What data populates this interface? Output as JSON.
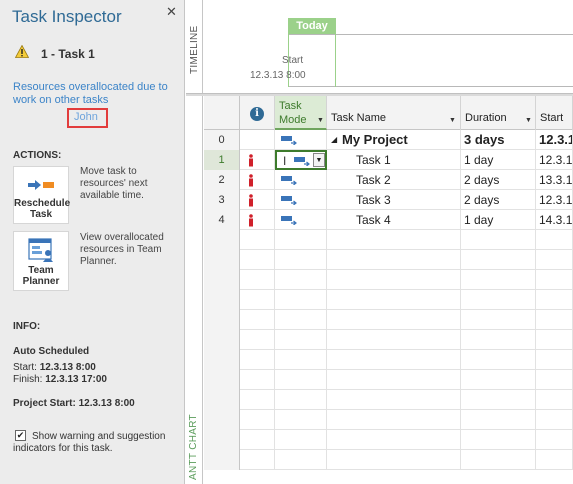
{
  "inspector": {
    "title": "Task Inspector",
    "close_glyph": "✕",
    "task_heading": "1 - Task 1",
    "message": "Resources overallocated due to work on other tasks",
    "resource_link": "John",
    "actions_label": "ACTIONS:",
    "actions": [
      {
        "label_line1": "Reschedule",
        "label_line2": "Task",
        "description": "Move task to resources' next available time.",
        "icon": "reschedule-icon"
      },
      {
        "label_line1": "Team",
        "label_line2": "Planner",
        "description": "View overallocated resources in Team Planner.",
        "icon": "team-planner-icon"
      }
    ],
    "info_label": "INFO:",
    "auto_scheduled": "Auto Scheduled",
    "start_label": "Start:",
    "start_value": "12.3.13 8:00",
    "finish_label": "Finish:",
    "finish_value": "12.3.13 17:00",
    "project_start_label": "Project Start:",
    "project_start_value": "12.3.13 8:00",
    "checkbox_checked": true,
    "checkbox_label": "Show warning and suggestion indicators for this task."
  },
  "timeline": {
    "side_label": "TIMELINE",
    "today_label": "Today",
    "start_label": "Start",
    "start_date": "12.3.13 8:00"
  },
  "gantt": {
    "side_label": "ANTT CHART",
    "columns": {
      "info_glyph": "i",
      "task_mode_line1": "Task",
      "task_mode_line2": "Mode",
      "task_name": "Task Name",
      "duration": "Duration",
      "start": "Start"
    },
    "rows": [
      {
        "id": "0",
        "name": "My Project",
        "duration": "3 days",
        "start": "12.3.1",
        "summary": true,
        "warning": false
      },
      {
        "id": "1",
        "name": "Task 1",
        "duration": "1 day",
        "start": "12.3.1",
        "summary": false,
        "warning": true,
        "selected": true
      },
      {
        "id": "2",
        "name": "Task 2",
        "duration": "2 days",
        "start": "13.3.1",
        "summary": false,
        "warning": true
      },
      {
        "id": "3",
        "name": "Task 3",
        "duration": "2 days",
        "start": "12.3.1",
        "summary": false,
        "warning": true
      },
      {
        "id": "4",
        "name": "Task 4",
        "duration": "1 day",
        "start": "14.3.1",
        "summary": false,
        "warning": true
      }
    ]
  },
  "colors": {
    "accent_blue": "#2f6a95",
    "link_blue": "#3c84c8",
    "warning_red": "#d0202a",
    "today_green": "#9bd18a",
    "gantt_green": "#5a9c5a"
  }
}
